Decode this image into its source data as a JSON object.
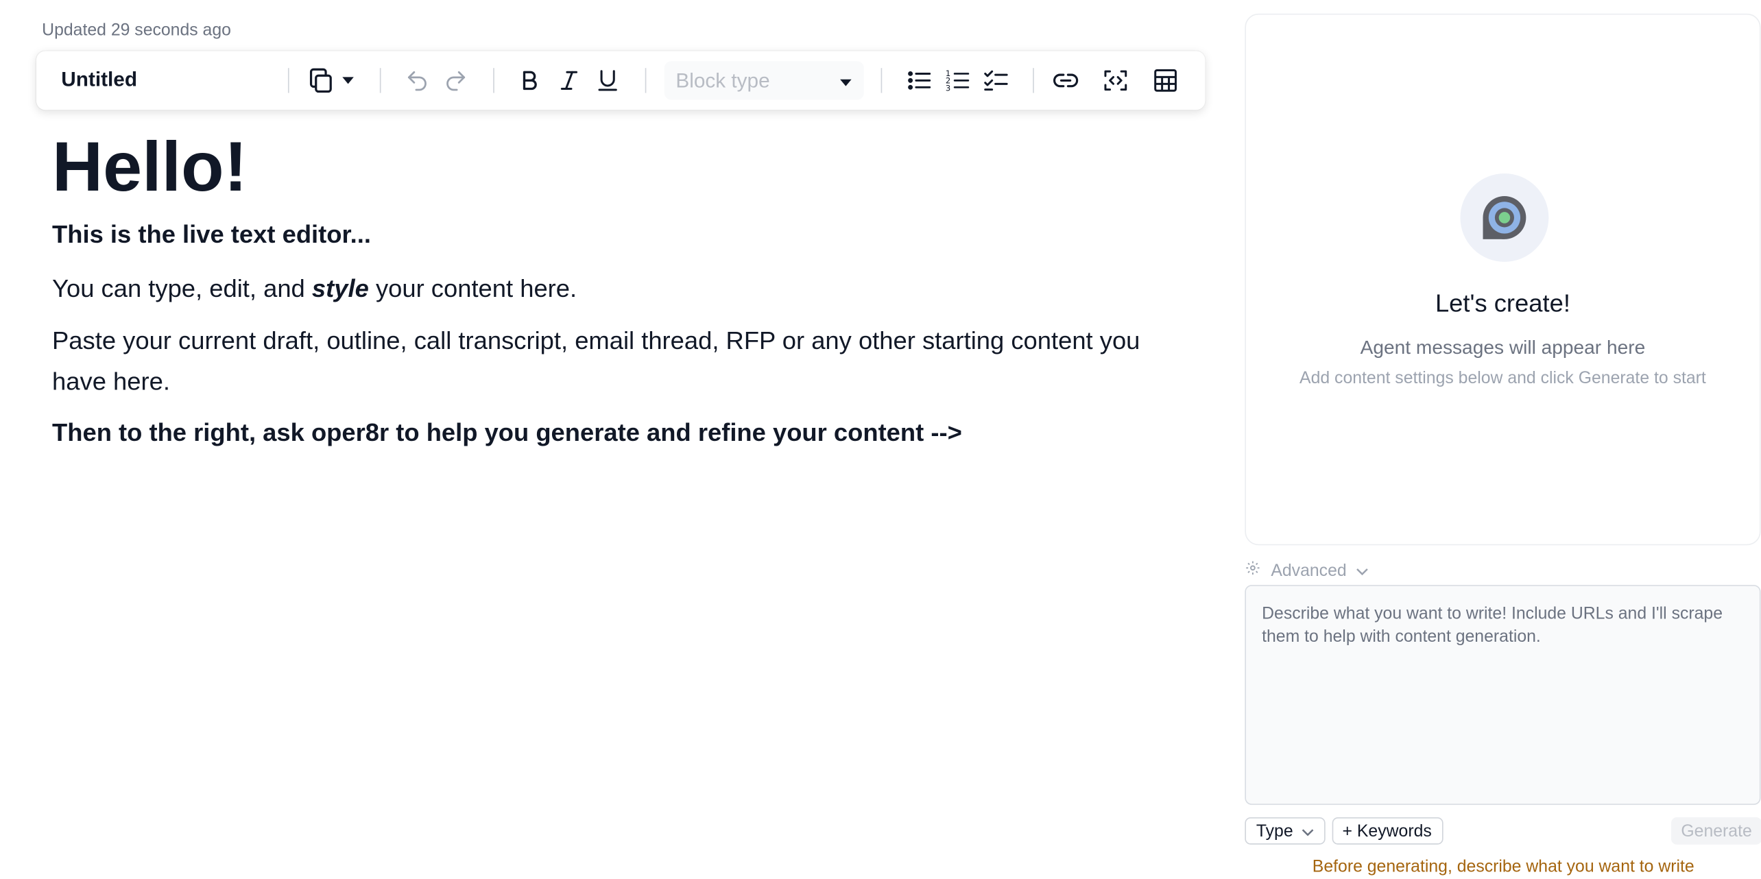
{
  "editor": {
    "updated_text": "Updated 29 seconds ago",
    "doc_title": "Untitled",
    "block_type_placeholder": "Block type",
    "heading": "Hello!",
    "subheading": "This is the live text editor...",
    "paragraph1": {
      "before": "You can type, edit, and ",
      "styled": "style",
      "after": " your content here."
    },
    "paragraph2": "Paste your current draft, outline, call transcript, email thread, RFP or any other starting content you have here.",
    "callout": "Then to the right, ask oper8r to help you generate and refine your content -->"
  },
  "toolbar_icons": [
    "copy-icon",
    "chevron-down-icon",
    "undo-icon",
    "redo-icon",
    "bold-icon",
    "italic-icon",
    "underline-icon",
    "bullet-list-icon",
    "numbered-list-icon",
    "checklist-icon",
    "link-icon",
    "embed-code-icon",
    "table-icon"
  ],
  "agent_panel": {
    "title": "Let's create!",
    "subtitle": "Agent messages will appear here",
    "hint": "Add content settings below and click Generate to start",
    "advanced_label": "Advanced",
    "prompt_placeholder": "Describe what you want to write! Include URLs and I'll scrape them to help with content generation.",
    "type_label": "Type",
    "keywords_label": "+ Keywords",
    "generate_label": "Generate",
    "warning": "Before generating, describe what you want to write"
  },
  "colors": {
    "text_primary": "#111827",
    "text_muted": "#6b7280",
    "warning": "#a5650f",
    "logo_ring": "#8fb3e6",
    "logo_center": "#7ccf8e",
    "logo_dark": "#5d5f66"
  }
}
